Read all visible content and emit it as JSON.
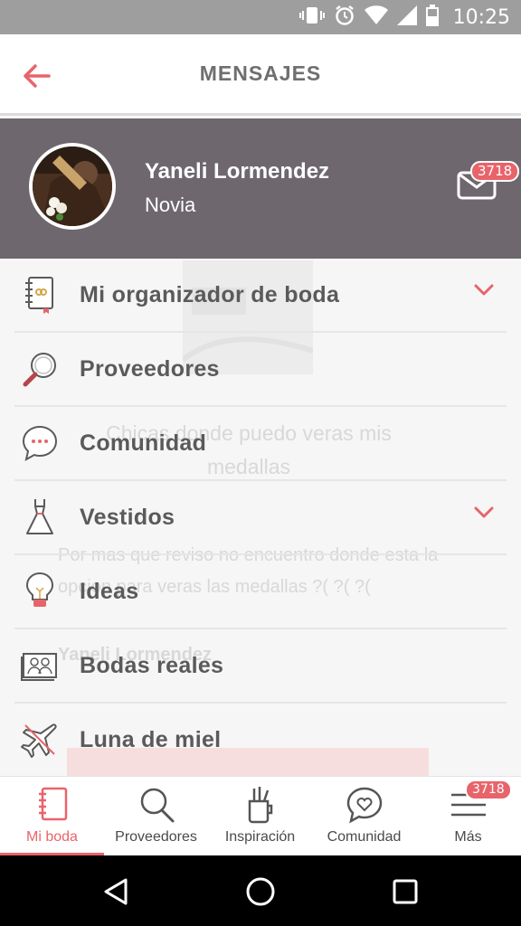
{
  "status_bar": {
    "time": "10:25"
  },
  "app_bar": {
    "title": "MENSAJES"
  },
  "profile": {
    "name": "Yaneli Lormendez",
    "role": "Novia",
    "message_count": "3718"
  },
  "menu": {
    "items": [
      {
        "label": "Mi organizador de boda",
        "icon": "notebook-icon",
        "expandable": true
      },
      {
        "label": "Proveedores",
        "icon": "magnifier-icon",
        "expandable": false
      },
      {
        "label": "Comunidad",
        "icon": "chat-bubble-icon",
        "expandable": false
      },
      {
        "label": "Vestidos",
        "icon": "dress-icon",
        "expandable": true
      },
      {
        "label": "Ideas",
        "icon": "lightbulb-icon",
        "expandable": false
      },
      {
        "label": "Bodas reales",
        "icon": "photo-album-icon",
        "expandable": false
      },
      {
        "label": "Luna de miel",
        "icon": "airplane-icon",
        "expandable": false
      }
    ]
  },
  "background_post": {
    "title": "Chicas donde puedo veras mis medallas",
    "body": "Por mas que reviso no encuentro donde esta la opcion para veras las medallas ?( ?( ?(",
    "author": "Yaneli Lormendez"
  },
  "bottom_nav": {
    "items": [
      {
        "label": "Mi boda",
        "active": true
      },
      {
        "label": "Proveedores",
        "active": false
      },
      {
        "label": "Inspiración",
        "active": false
      },
      {
        "label": "Comunidad",
        "active": false
      },
      {
        "label": "Más",
        "active": false
      }
    ],
    "badge": "3718"
  },
  "colors": {
    "accent": "#e8646b",
    "header_bg": "#6e676e",
    "text": "#5a5a5a"
  }
}
